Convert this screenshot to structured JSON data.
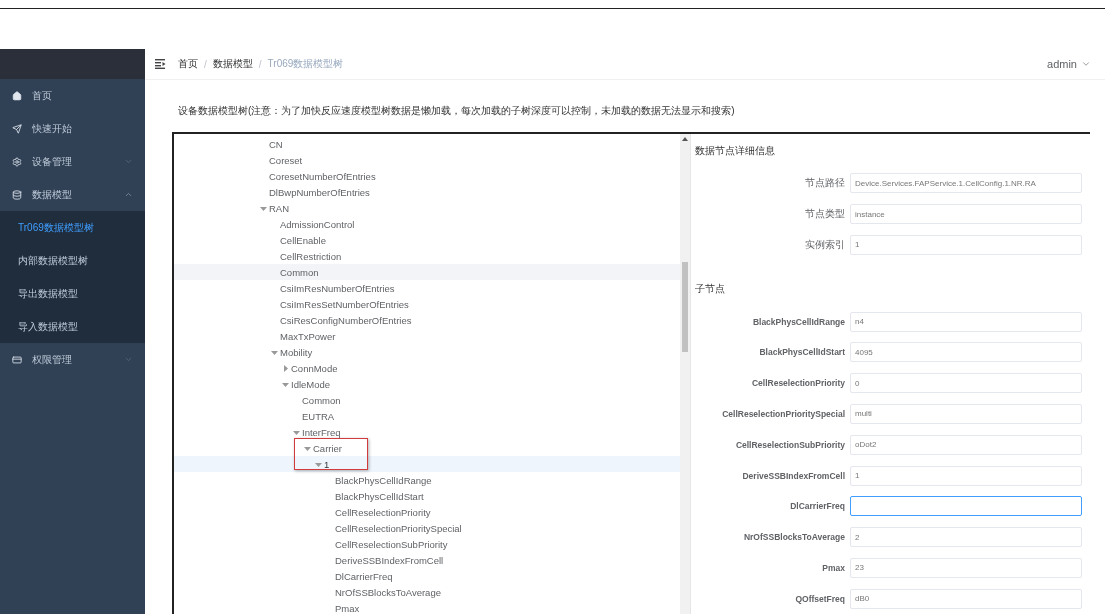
{
  "sidebar": {
    "items": [
      {
        "label": "首页",
        "has_submenu": false
      },
      {
        "label": "快速开始",
        "has_submenu": false
      },
      {
        "label": "设备管理",
        "expanded": false,
        "has_submenu": true
      },
      {
        "label": "数据模型",
        "expanded": true,
        "has_submenu": true,
        "children": [
          {
            "label": "Tr069数据模型树",
            "selected": true
          },
          {
            "label": "内部数据模型树",
            "selected": false
          },
          {
            "label": "导出数据模型",
            "selected": false
          },
          {
            "label": "导入数据模型",
            "selected": false
          }
        ]
      },
      {
        "label": "权限管理",
        "expanded": false,
        "has_submenu": true
      }
    ]
  },
  "breadcrumb": {
    "separator": "/",
    "items": [
      "首页",
      "数据模型",
      "Tr069数据模型树"
    ]
  },
  "user": "admin",
  "notice": "设备数据模型树(注意：为了加快反应速度模型树数据是懒加载，每次加载的子树深度可以控制，未加载的数据无法显示和搜索)",
  "tree": [
    {
      "label": "CN",
      "selected": false,
      "highlighted": false,
      "outlined": false
    },
    {
      "label": "Coreset",
      "selected": false,
      "highlighted": false,
      "outlined": false
    },
    {
      "label": "CoresetNumberOfEntries",
      "selected": false,
      "highlighted": false,
      "outlined": false
    },
    {
      "label": "DlBwpNumberOfEntries",
      "selected": false,
      "highlighted": false,
      "outlined": false
    },
    {
      "label": "RAN",
      "expanded": true,
      "selected": false,
      "highlighted": false,
      "outlined": false,
      "children": [
        {
          "label": "AdmissionControl",
          "selected": false,
          "highlighted": false,
          "outlined": false
        },
        {
          "label": "CellEnable",
          "selected": false,
          "highlighted": false,
          "outlined": false
        },
        {
          "label": "CellRestriction",
          "selected": false,
          "highlighted": false,
          "outlined": false
        },
        {
          "label": "Common",
          "selected": false,
          "highlighted": true,
          "outlined": false
        },
        {
          "label": "CsiImResNumberOfEntries",
          "selected": false,
          "highlighted": false,
          "outlined": false
        },
        {
          "label": "CsiImResSetNumberOfEntries",
          "selected": false,
          "highlighted": false,
          "outlined": false
        },
        {
          "label": "CsiResConfigNumberOfEntries",
          "selected": false,
          "highlighted": false,
          "outlined": false
        },
        {
          "label": "MaxTxPower",
          "selected": false,
          "highlighted": false,
          "outlined": false
        },
        {
          "label": "Mobility",
          "expanded": true,
          "selected": false,
          "highlighted": false,
          "outlined": false,
          "children": [
            {
              "label": "ConnMode",
              "expanded": false,
              "selected": false,
              "highlighted": false,
              "outlined": false
            },
            {
              "label": "IdleMode",
              "expanded": true,
              "selected": false,
              "highlighted": false,
              "outlined": false,
              "children": [
                {
                  "label": "Common",
                  "selected": false,
                  "highlighted": false,
                  "outlined": false
                },
                {
                  "label": "EUTRA",
                  "selected": false,
                  "highlighted": false,
                  "outlined": false
                },
                {
                  "label": "InterFreq",
                  "expanded": true,
                  "selected": false,
                  "highlighted": false,
                  "outlined": false,
                  "children": [
                    {
                      "label": "Carrier",
                      "expanded": true,
                      "selected": false,
                      "highlighted": false,
                      "outlined": true,
                      "children": [
                        {
                          "label": "1",
                          "expanded": true,
                          "selected": true,
                          "highlighted": false,
                          "outlined": false,
                          "children": [
                            {
                              "label": "BlackPhysCellIdRange",
                              "selected": false,
                              "highlighted": false,
                              "outlined": false
                            },
                            {
                              "label": "BlackPhysCellIdStart",
                              "selected": false,
                              "highlighted": false,
                              "outlined": false
                            },
                            {
                              "label": "CellReselectionPriority",
                              "selected": false,
                              "highlighted": false,
                              "outlined": false
                            },
                            {
                              "label": "CellReselectionPrioritySpecial",
                              "selected": false,
                              "highlighted": false,
                              "outlined": false
                            },
                            {
                              "label": "CellReselectionSubPriority",
                              "selected": false,
                              "highlighted": false,
                              "outlined": false
                            },
                            {
                              "label": "DeriveSSBIndexFromCell",
                              "selected": false,
                              "highlighted": false,
                              "outlined": false
                            },
                            {
                              "label": "DlCarrierFreq",
                              "selected": false,
                              "highlighted": false,
                              "outlined": false
                            },
                            {
                              "label": "NrOfSSBlocksToAverage",
                              "selected": false,
                              "highlighted": false,
                              "outlined": false
                            },
                            {
                              "label": "Pmax",
                              "selected": false,
                              "highlighted": false,
                              "outlined": false
                            }
                          ]
                        }
                      ]
                    }
                  ]
                }
              ]
            }
          ]
        }
      ]
    }
  ],
  "details": {
    "title": "数据节点详细信息",
    "fields": [
      {
        "label": "节点路径",
        "value": "Device.Services.FAPService.1.CellConfig.1.NR.RA"
      },
      {
        "label": "节点类型",
        "value": "instance"
      },
      {
        "label": "实例索引",
        "value": "1"
      }
    ],
    "children_title": "子节点",
    "children": [
      {
        "label": "BlackPhysCellIdRange",
        "value": "n4",
        "focused": false
      },
      {
        "label": "BlackPhysCellIdStart",
        "value": "4095",
        "focused": false
      },
      {
        "label": "CellReselectionPriority",
        "value": "0",
        "focused": false
      },
      {
        "label": "CellReselectionPrioritySpecial",
        "value": "multi",
        "focused": false
      },
      {
        "label": "CellReselectionSubPriority",
        "value": "oDot2",
        "focused": false
      },
      {
        "label": "DeriveSSBIndexFromCell",
        "value": "1",
        "focused": false
      },
      {
        "label": "DlCarrierFreq",
        "focused": true
      },
      {
        "label": "NrOfSSBlocksToAverage",
        "value": "2",
        "focused": false
      },
      {
        "label": "Pmax",
        "value": "23",
        "focused": false
      },
      {
        "label": "QOffsetFreq",
        "value": "dB0",
        "focused": false
      }
    ]
  }
}
